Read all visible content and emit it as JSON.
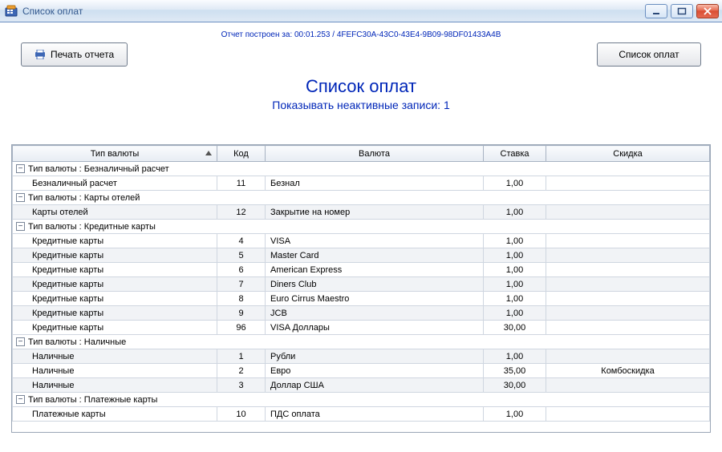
{
  "window": {
    "title": "Список оплат"
  },
  "report_meta": {
    "prefix": "Отчет построен за:",
    "time": "00:01.253",
    "guid": "4FEFC30A-43C0-43E4-9B09-98DF01433A4B"
  },
  "toolbar": {
    "print_label": "Печать отчета",
    "list_label": "Список оплат"
  },
  "page": {
    "title": "Список оплат",
    "subtitle_prefix": "Показывать неактивные записи:",
    "subtitle_value": "1"
  },
  "columns": {
    "currency_type": "Тип валюты",
    "code": "Код",
    "currency": "Валюта",
    "rate": "Ставка",
    "discount": "Скидка"
  },
  "groups": [
    {
      "label": "Тип валюты : Безналичный расчет",
      "rows": [
        {
          "type": "Безналичный расчет",
          "code": "11",
          "currency": "Безнал",
          "rate": "1,00",
          "discount": ""
        }
      ]
    },
    {
      "label": "Тип валюты : Карты отелей",
      "rows": [
        {
          "type": "Карты отелей",
          "code": "12",
          "currency": "Закрытие на номер",
          "rate": "1,00",
          "discount": ""
        }
      ]
    },
    {
      "label": "Тип валюты : Кредитные карты",
      "rows": [
        {
          "type": "Кредитные карты",
          "code": "4",
          "currency": "VISA",
          "rate": "1,00",
          "discount": ""
        },
        {
          "type": "Кредитные карты",
          "code": "5",
          "currency": "Master Card",
          "rate": "1,00",
          "discount": ""
        },
        {
          "type": "Кредитные карты",
          "code": "6",
          "currency": "American Express",
          "rate": "1,00",
          "discount": ""
        },
        {
          "type": "Кредитные карты",
          "code": "7",
          "currency": "Diners Club",
          "rate": "1,00",
          "discount": ""
        },
        {
          "type": "Кредитные карты",
          "code": "8",
          "currency": "Euro Cirrus Maestro",
          "rate": "1,00",
          "discount": ""
        },
        {
          "type": "Кредитные карты",
          "code": "9",
          "currency": "JCB",
          "rate": "1,00",
          "discount": ""
        },
        {
          "type": "Кредитные карты",
          "code": "96",
          "currency": "VISA Доллары",
          "rate": "30,00",
          "discount": ""
        }
      ]
    },
    {
      "label": "Тип валюты : Наличные",
      "rows": [
        {
          "type": "Наличные",
          "code": "1",
          "currency": "Рубли",
          "rate": "1,00",
          "discount": ""
        },
        {
          "type": "Наличные",
          "code": "2",
          "currency": "Евро",
          "rate": "35,00",
          "discount": "Комбоскидка"
        },
        {
          "type": "Наличные",
          "code": "3",
          "currency": "Доллар США",
          "rate": "30,00",
          "discount": ""
        }
      ]
    },
    {
      "label": "Тип валюты : Платежные карты",
      "rows": [
        {
          "type": "Платежные карты",
          "code": "10",
          "currency": "ПДС оплата",
          "rate": "1,00",
          "discount": ""
        }
      ]
    }
  ]
}
